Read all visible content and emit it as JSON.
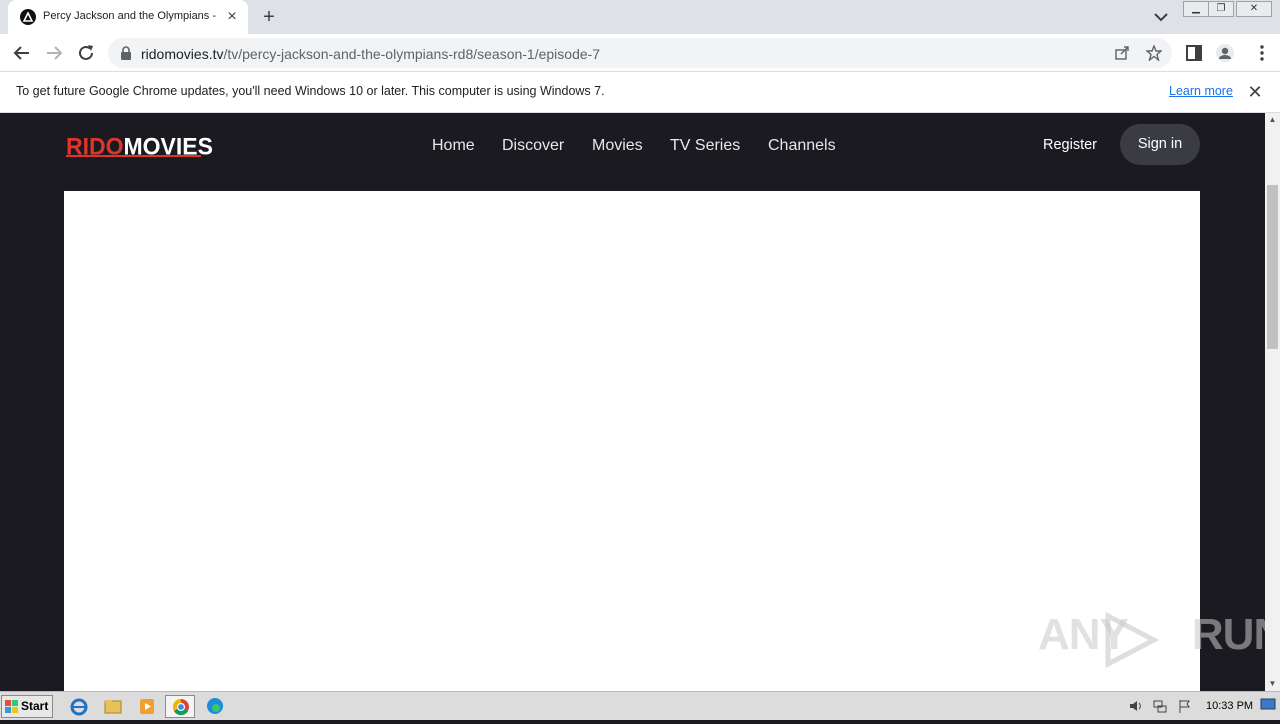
{
  "browser": {
    "tab": {
      "title": "Percy Jackson and the Olympians - S",
      "favicon": "ridomovies-favicon"
    },
    "url": {
      "host": "ridomovies.tv",
      "path": "/tv/percy-jackson-and-the-olympians-rd8/season-1/episode-7"
    },
    "infobar": {
      "message": "To get future Google Chrome updates, you'll need Windows 10 or later. This computer is using Windows 7.",
      "link": "Learn more"
    }
  },
  "site": {
    "logo": {
      "part1": "RIDO",
      "part2": "MOVIES"
    },
    "nav": [
      "Home",
      "Discover",
      "Movies",
      "TV Series",
      "Channels"
    ],
    "register": "Register",
    "signin": "Sign in",
    "colors": {
      "accent": "#e0342b",
      "background": "#1b1a20",
      "button": "#3b3c42"
    }
  },
  "watermark": {
    "left": "ANY",
    "right": "RUN"
  },
  "taskbar": {
    "start": "Start",
    "clock": "10:33 PM"
  }
}
